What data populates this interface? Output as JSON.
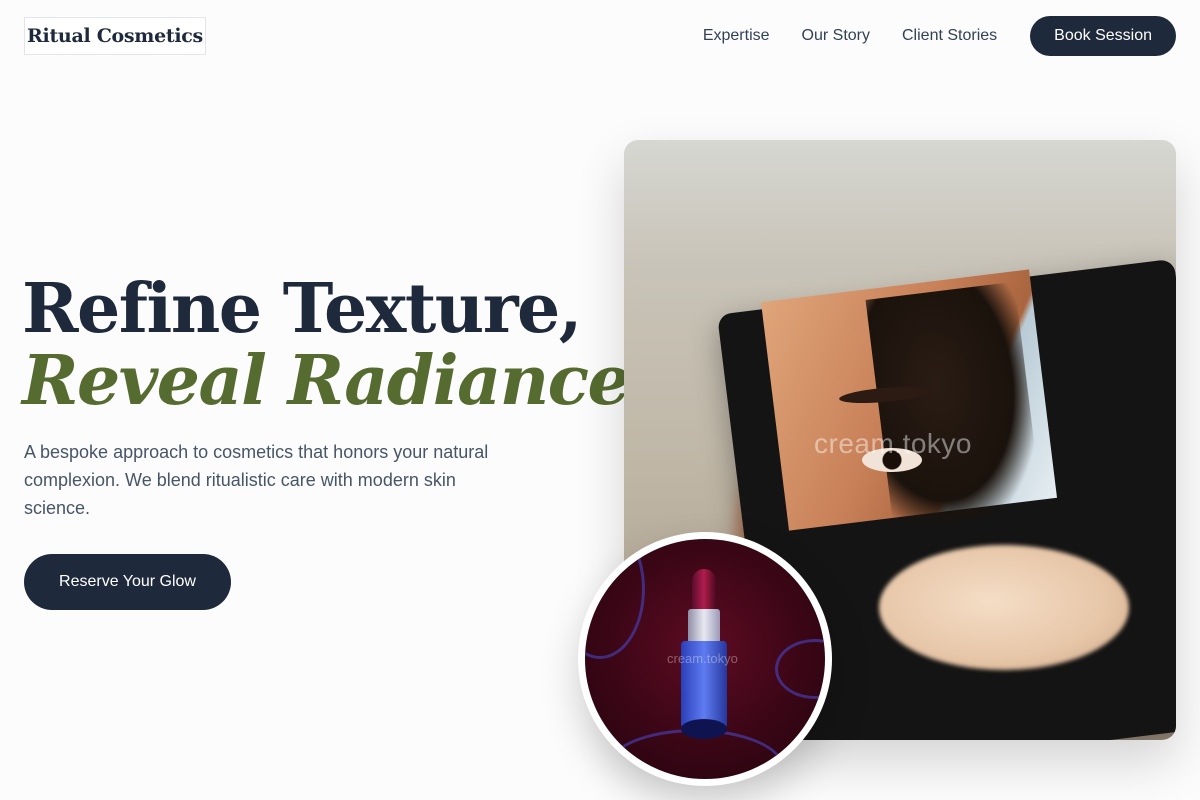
{
  "brand": {
    "name": "Ritual Cosmetics"
  },
  "nav": {
    "links": [
      "Expertise",
      "Our Story",
      "Client Stories"
    ],
    "cta_label": "Book Session"
  },
  "hero": {
    "headline_line1": "Refine Texture,",
    "headline_line2": "Reveal Radiance.",
    "lede": "A bespoke approach to cosmetics that honors your natural complexion. We blend ritualistic care with modern skin science.",
    "cta_label": "Reserve Your Glow"
  },
  "media": {
    "main_watermark": "cream.tokyo",
    "inset_watermark": "cream.tokyo"
  },
  "colors": {
    "primary": "#1e293b",
    "accent_olive": "#556b2f",
    "body_text": "#475569",
    "background": "#fcfcfc"
  }
}
